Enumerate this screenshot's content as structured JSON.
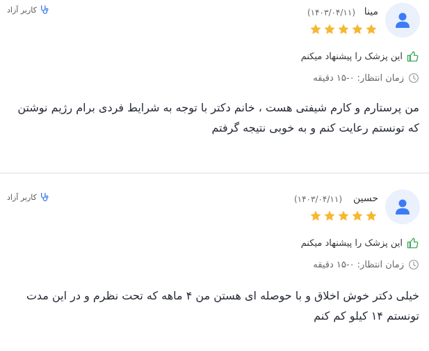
{
  "reviews": [
    {
      "name": "مینا",
      "date": "(۱۴۰۳/۰۴/۱۱)",
      "rating": 5,
      "user_tag": "کاربر آزاد",
      "recommend": "این پزشک را پیشنهاد میکنم",
      "wait_time": "زمان انتظار: ۰-۱۵ دقیقه",
      "text": "من پرستارم و کارم شیفتی هست ، خانم دکتر با توجه به شرایط فردی برام رژیم نوشتن که تونستم رعایت کنم و به خوبی نتیجه گرفتم"
    },
    {
      "name": "حسین",
      "date": "(۱۴۰۳/۰۴/۱۱)",
      "rating": 5,
      "user_tag": "کاربر آزاد",
      "recommend": "این پزشک را پیشنهاد میکنم",
      "wait_time": "زمان انتظار: ۰-۱۵ دقیقه",
      "text": "خیلی دکتر خوش اخلاق و با حوصله ای هستن من ۴ ماهه که تحت نظرم و در این مدت تونستم ۱۴ کیلو کم کنم"
    }
  ],
  "colors": {
    "accent": "#3b7cf6",
    "star": "#f7b731",
    "recommend": "#3aa856"
  }
}
